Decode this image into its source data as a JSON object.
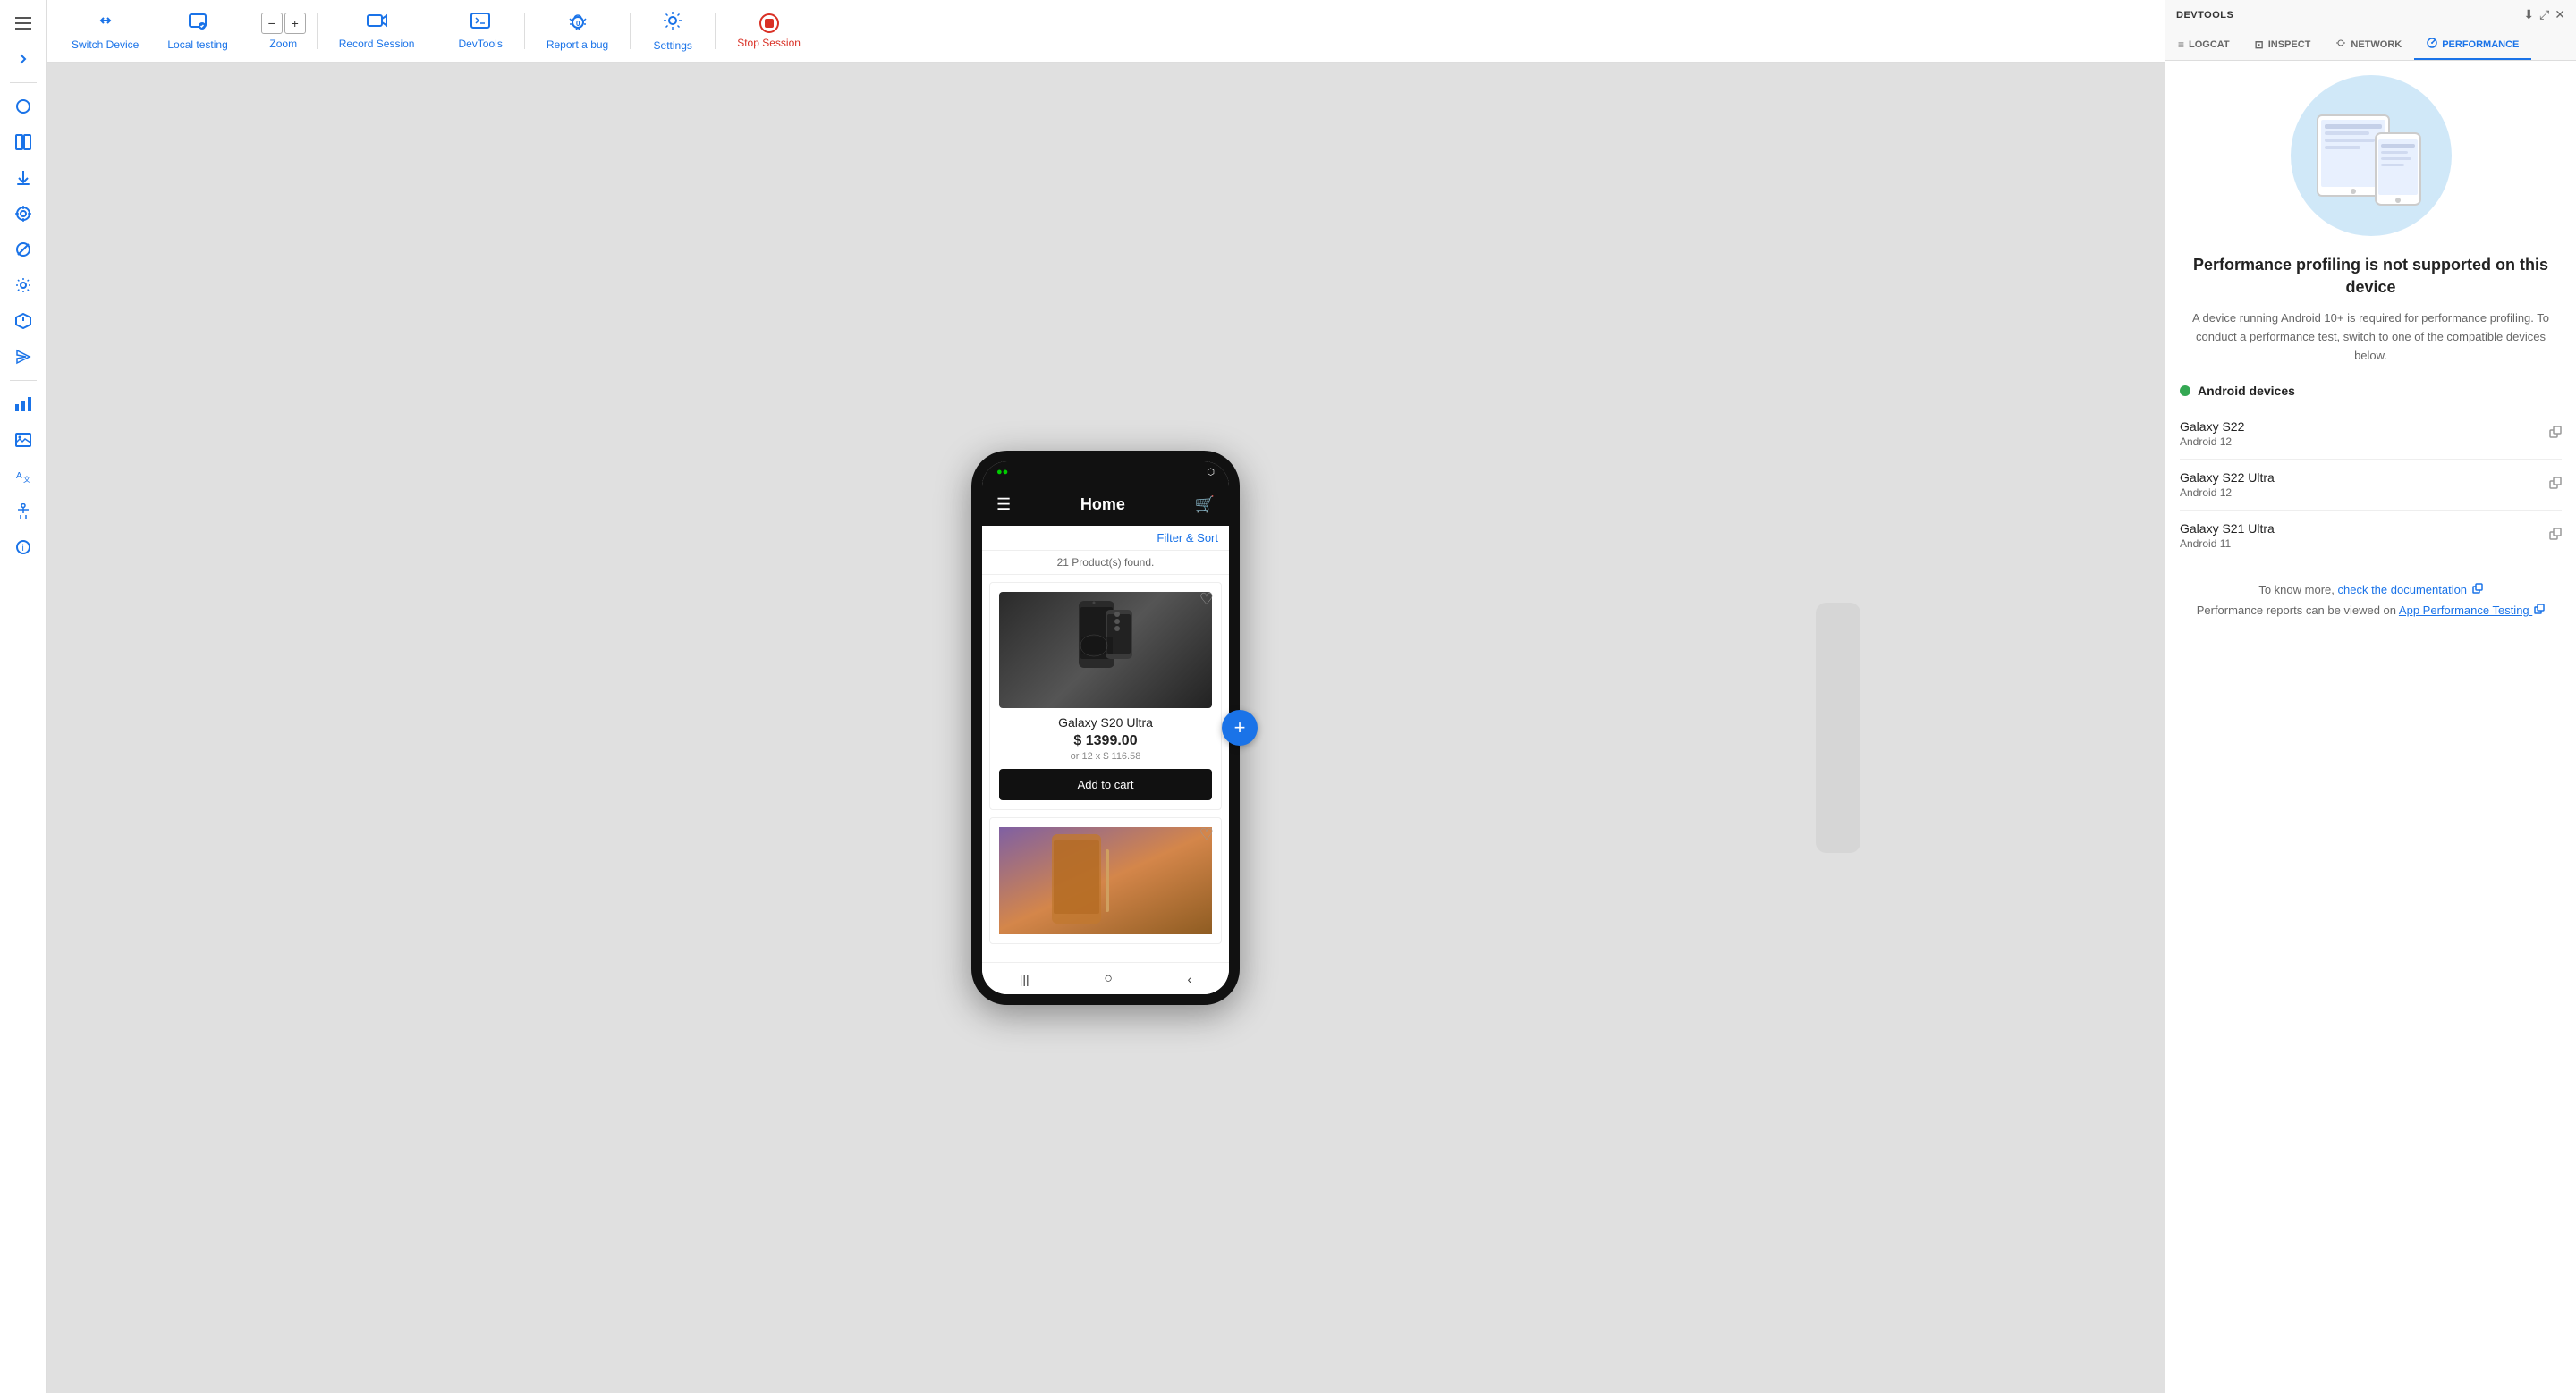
{
  "sidebar": {
    "icons": [
      {
        "name": "menu-icon",
        "symbol": "☰",
        "interactable": true
      },
      {
        "name": "forward-icon",
        "symbol": "→",
        "interactable": true
      },
      {
        "name": "circle-icon",
        "symbol": "○",
        "interactable": true
      },
      {
        "name": "sidebar-toggle-icon",
        "symbol": "▣",
        "interactable": true
      },
      {
        "name": "download-icon",
        "symbol": "⬇",
        "interactable": true
      },
      {
        "name": "target-icon",
        "symbol": "◎",
        "interactable": true
      },
      {
        "name": "block-icon",
        "symbol": "⊘",
        "interactable": true
      },
      {
        "name": "settings-icon",
        "symbol": "⚙",
        "interactable": true
      },
      {
        "name": "tag-icon",
        "symbol": "⬡",
        "interactable": true
      },
      {
        "name": "send-icon",
        "symbol": "✈",
        "interactable": true
      },
      {
        "name": "bar-chart-icon",
        "symbol": "▦",
        "interactable": true
      },
      {
        "name": "image-icon",
        "symbol": "⬜",
        "interactable": true
      },
      {
        "name": "translate-icon",
        "symbol": "A→",
        "interactable": true
      },
      {
        "name": "accessibility-icon",
        "symbol": "♿",
        "interactable": true
      },
      {
        "name": "info-icon",
        "symbol": "ℹ",
        "interactable": true
      }
    ]
  },
  "toolbar": {
    "switch_device_label": "Switch Device",
    "local_testing_label": "Local testing",
    "zoom_label": "Zoom",
    "record_session_label": "Record Session",
    "devtools_label": "DevTools",
    "report_bug_label": "Report a bug",
    "settings_label": "Settings",
    "stop_session_label": "Stop Session"
  },
  "phone": {
    "status_bar": {
      "signal": "••",
      "battery": "□"
    },
    "app_bar_title": "Home",
    "filter_sort": "Filter & Sort",
    "products_found": "21 Product(s) found.",
    "product1": {
      "name": "Galaxy S20 Ultra",
      "price": "$ 1399.00",
      "installment": "or 12 x $ 116.58",
      "add_to_cart": "Add to cart"
    },
    "product2": {
      "heart": "♡"
    },
    "nav_bars": [
      "|||",
      "○",
      "‹"
    ]
  },
  "devtools": {
    "title": "DEVTOOLS",
    "tabs": [
      {
        "id": "logcat",
        "label": "LOGCAT",
        "icon": "≡"
      },
      {
        "id": "inspect",
        "label": "INSPECT",
        "icon": "⊡"
      },
      {
        "id": "network",
        "label": "NETWORK",
        "icon": "⌘"
      },
      {
        "id": "performance",
        "label": "PERFORMANCE",
        "icon": "📊",
        "active": true
      }
    ],
    "header_actions": {
      "download": "⬇",
      "expand": "⤢",
      "close": "✕"
    },
    "performance": {
      "title": "Performance profiling is not supported on this device",
      "description": "A device running Android 10+ is required for performance profiling. To conduct a performance test, switch to one of the compatible devices below.",
      "android_section_label": "Android devices",
      "devices": [
        {
          "name": "Galaxy S22",
          "os": "Android 12"
        },
        {
          "name": "Galaxy S22 Ultra",
          "os": "Android 12"
        },
        {
          "name": "Galaxy S21 Ultra",
          "os": "Android 11"
        }
      ],
      "footer_text": "To know more,",
      "check_docs_link": "check the documentation",
      "app_testing_prefix": "Performance reports can be viewed on",
      "app_testing_link": "App Performance Testing"
    }
  }
}
